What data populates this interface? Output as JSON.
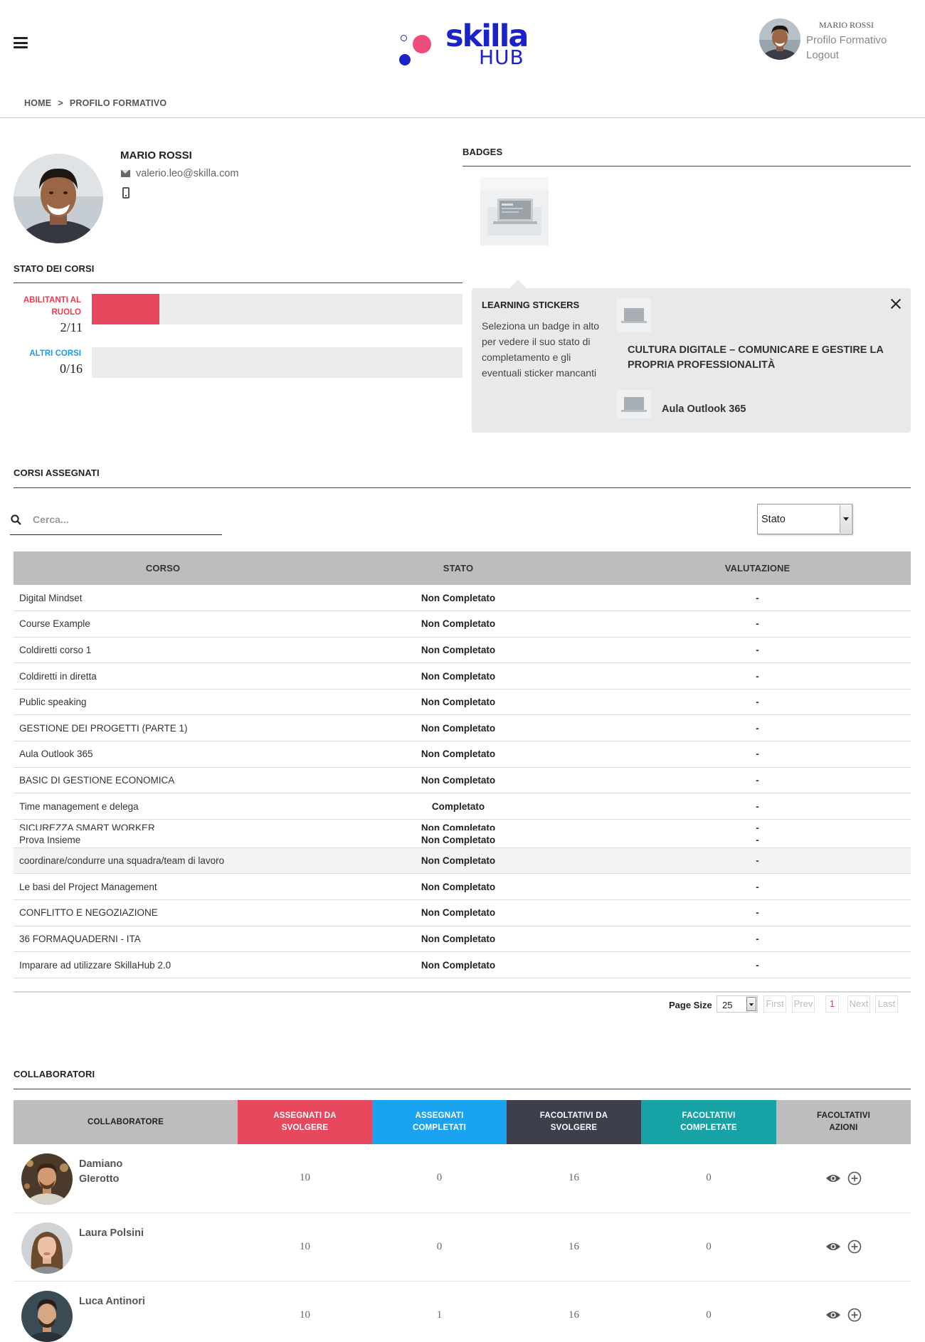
{
  "header": {
    "logo_word": "skilla",
    "logo_sub": "HUB",
    "user": {
      "name": "MARIO ROSSI",
      "links": [
        "Profilo Formativo",
        "Logout"
      ]
    }
  },
  "breadcrumb": {
    "items": [
      "HOME",
      "PROFILO FORMATIVO"
    ],
    "separator": ">"
  },
  "profile": {
    "name": "MARIO ROSSI",
    "email": "valerio.leo@skilla.com"
  },
  "stato_corsi": {
    "title": "STATO DEI CORSI",
    "bars": [
      {
        "label": "ABILITANTI AL RUOLO",
        "count": "2/11",
        "color": "#e8485e",
        "label_color": "#e83b4f",
        "fraction": 0.1818
      },
      {
        "label": "ALTRI CORSI",
        "count": "0/16",
        "color": "#1e9be8",
        "label_color": "#1e9be8",
        "fraction": 0
      }
    ]
  },
  "badges": {
    "title": "BADGES"
  },
  "stickers": {
    "title": "LEARNING STICKERS",
    "text": "Seleziona un badge in alto per vedere il suo stato di completamento e gli eventuali sticker mancanti",
    "course_title": "CULTURA DIGITALE – COMUNICARE E GESTIRE LA PROPRIA PROFESSIONALITÀ",
    "item": "Aula Outlook 365"
  },
  "corsi": {
    "title": "CORSI ASSEGNATI",
    "search_placeholder": "Cerca...",
    "filter_value": "Stato",
    "columns": [
      "CORSO",
      "STATO",
      "VALUTAZIONE"
    ],
    "rows": [
      {
        "corso": "Digital Mindset",
        "stato": "Non Completato",
        "valutazione": "-"
      },
      {
        "corso": "Course Example",
        "stato": "Non Completato",
        "valutazione": "-"
      },
      {
        "corso": "Coldiretti corso 1",
        "stato": "Non Completato",
        "valutazione": "-"
      },
      {
        "corso": "Coldiretti in diretta",
        "stato": "Non Completato",
        "valutazione": "-"
      },
      {
        "corso": "Public speaking",
        "stato": "Non Completato",
        "valutazione": "-"
      },
      {
        "corso": "GESTIONE DEI PROGETTI (PARTE 1)",
        "stato": "Non Completato",
        "valutazione": "-"
      },
      {
        "corso": "Aula Outlook 365",
        "stato": "Non Completato",
        "valutazione": "-"
      },
      {
        "corso": "BASIC DI GESTIONE ECONOMICA",
        "stato": "Non Completato",
        "valutazione": "-"
      },
      {
        "corso": "Time management e delega",
        "stato": "Completato",
        "valutazione": "-"
      },
      {
        "corso": "SICUREZZA SMART WORKER",
        "stato": "Non Completato",
        "valutazione": "-"
      },
      {
        "corso": "Prova Insieme",
        "stato": "Non Completato",
        "valutazione": "-"
      },
      {
        "corso": "coordinare/condurre una squadra/team di lavoro",
        "stato": "Non Completato",
        "valutazione": "-"
      },
      {
        "corso": "Le basi del Project Management",
        "stato": "Non Completato",
        "valutazione": "-"
      },
      {
        "corso": "CONFLITTO E NEGOZIAZIONE",
        "stato": "Non Completato",
        "valutazione": "-"
      },
      {
        "corso": "36 FORMAQUADERNI - ITA",
        "stato": "Non Completato",
        "valutazione": "-"
      },
      {
        "corso": "Imparare ad utilizzare SkillaHub 2.0",
        "stato": "Non Completato",
        "valutazione": "-"
      }
    ],
    "pager": {
      "page_size_label": "Page Size",
      "page_size": "25",
      "first": "First",
      "prev": "Prev",
      "current": "1",
      "next": "Next",
      "last": "Last"
    }
  },
  "collaboratori": {
    "title": "COLLABORATORI",
    "columns": [
      {
        "label": "COLLABORATORE",
        "bg": "#bdbdbd",
        "color": "#222"
      },
      {
        "label": "ASSEGNATI DA SVOLGERE",
        "bg": "#e8485e",
        "color": "#fff"
      },
      {
        "label": "ASSEGNATI COMPLETATI",
        "bg": "#1aa3f0",
        "color": "#fff"
      },
      {
        "label": "FACOLTATIVI DA SVOLGERE",
        "bg": "#3d3f4c",
        "color": "#fff"
      },
      {
        "label": "FACOLTATIVI COMPLETATE",
        "bg": "#17a2a6",
        "color": "#fff"
      },
      {
        "label": "FACOLTATIVI AZIONI",
        "bg": "#bdbdbd",
        "color": "#222"
      }
    ],
    "rows": [
      {
        "name": "Damiano GIerotto",
        "values": [
          "10",
          "0",
          "16",
          "0"
        ],
        "icons": [
          "eye-icon",
          "plus-circle-icon"
        ]
      },
      {
        "name": "Laura Polsini",
        "values": [
          "10",
          "0",
          "16",
          "0"
        ],
        "icons": [
          "eye-icon",
          "plus-circle-icon"
        ]
      },
      {
        "name": "Luca Antinori",
        "values": [
          "10",
          "1",
          "16",
          "0"
        ],
        "icons": [
          "eye-icon",
          "plus-circle-icon"
        ]
      }
    ]
  }
}
